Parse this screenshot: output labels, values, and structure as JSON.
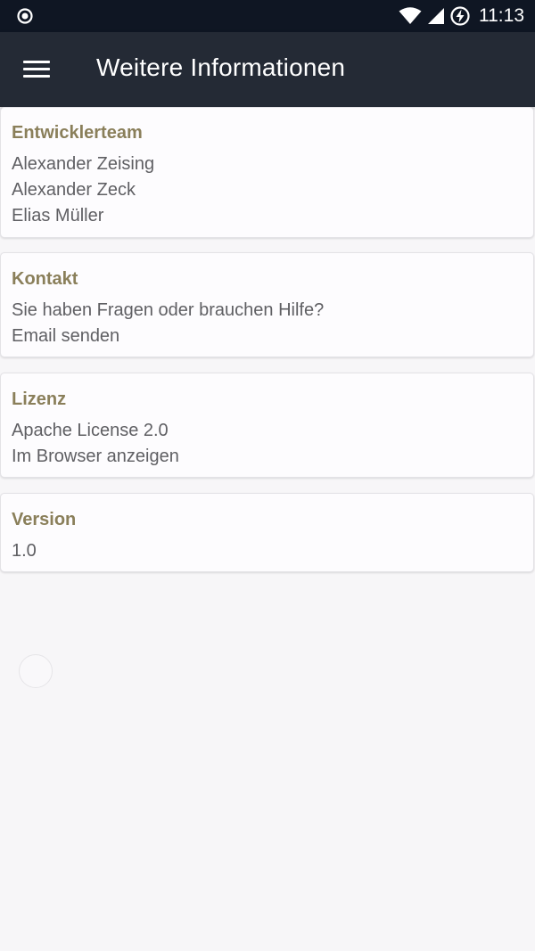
{
  "status_bar": {
    "time": "11:13",
    "icons": [
      "record-icon",
      "wifi-icon",
      "signal-icon",
      "battery-charging-icon"
    ]
  },
  "app_bar": {
    "title": "Weitere Informationen",
    "menu_icon": "hamburger-menu-icon"
  },
  "sections": {
    "team": {
      "title": "Entwicklerteam",
      "members": [
        "Alexander Zeising",
        "Alexander Zeck",
        "Elias Müller"
      ]
    },
    "contact": {
      "title": "Kontakt",
      "question": "Sie haben Fragen oder brauchen Hilfe?",
      "action": "Email senden"
    },
    "license": {
      "title": "Lizenz",
      "name": "Apache License 2.0",
      "action": "Im Browser anzeigen"
    },
    "version": {
      "title": "Version",
      "value": "1.0"
    }
  },
  "colors": {
    "status_bar": "#0f1623",
    "app_bar": "#242a35",
    "section_title": "#8a7f5a",
    "body_text": "#5f5f63",
    "background": "#f7f6f8"
  }
}
